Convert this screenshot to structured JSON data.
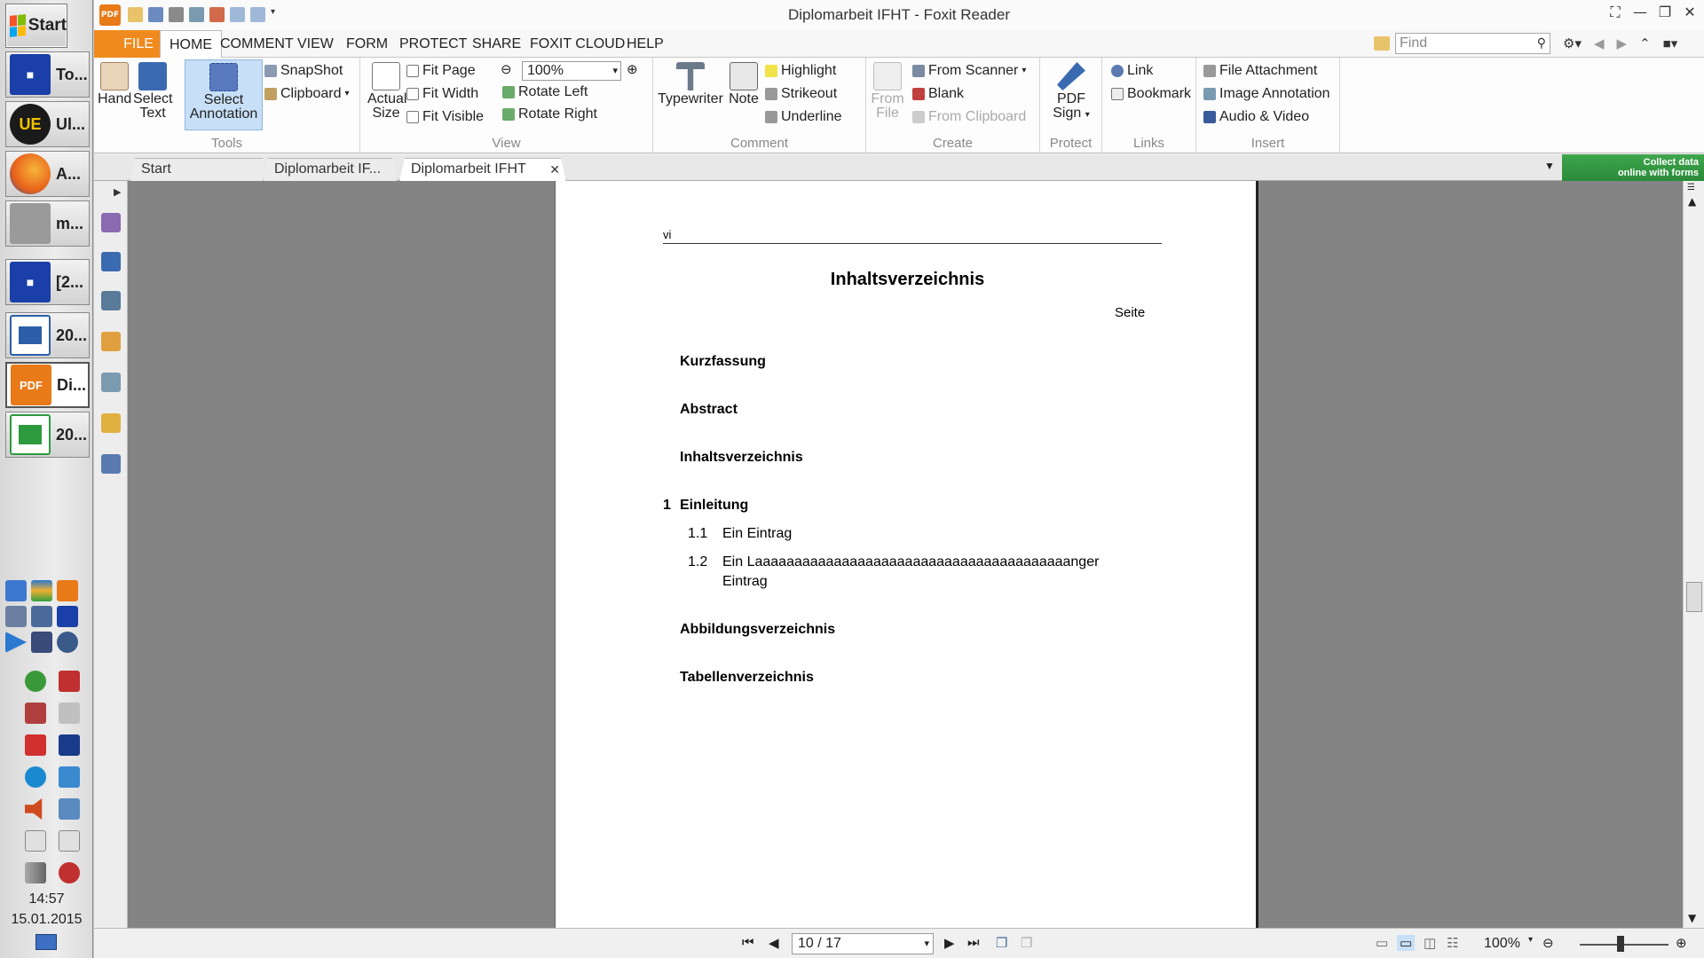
{
  "taskbar": {
    "start_label": "Start",
    "items": [
      {
        "label": "To...",
        "icon": "floppy-icon",
        "color": "#1a3fa8"
      },
      {
        "label": "Ul...",
        "icon": "ultraedit-icon",
        "color": "#1a1a1a"
      },
      {
        "label": "A...",
        "icon": "firefox-icon",
        "color": "#e8621a"
      },
      {
        "label": "m...",
        "icon": "printer-icon",
        "color": "#7a7a7a"
      },
      {
        "label": "[2...",
        "icon": "floppy-icon",
        "color": "#1a3fa8"
      },
      {
        "label": "20...",
        "icon": "writer-icon",
        "color": "#2b5fa8"
      },
      {
        "label": "Di...",
        "icon": "pdf-icon",
        "color": "#e87a18"
      },
      {
        "label": "20...",
        "icon": "calc-icon",
        "color": "#2e9a3e"
      }
    ],
    "clock_time": "14:57",
    "clock_date": "15.01.2015"
  },
  "window": {
    "title": "Diplomarbeit IFHT - Foxit Reader",
    "logo_text": "PDF"
  },
  "ribbon_tabs": [
    "FILE",
    "HOME",
    "COMMENT",
    "VIEW",
    "FORM",
    "PROTECT",
    "SHARE",
    "FOXIT CLOUD",
    "HELP"
  ],
  "find": {
    "placeholder": "Find"
  },
  "ribbon": {
    "tools": {
      "label": "Tools",
      "hand": "Hand",
      "select_text_1": "Select",
      "select_text_2": "Text",
      "select_annot_1": "Select",
      "select_annot_2": "Annotation",
      "snapshot": "SnapShot",
      "clipboard": "Clipboard"
    },
    "view": {
      "label": "View",
      "actual_1": "Actual",
      "actual_2": "Size",
      "fit_page": "Fit Page",
      "fit_width": "Fit Width",
      "fit_visible": "Fit Visible",
      "zoom": "100%",
      "rotate_left": "Rotate Left",
      "rotate_right": "Rotate Right"
    },
    "comment": {
      "label": "Comment",
      "typewriter": "Typewriter",
      "note": "Note",
      "highlight": "Highlight",
      "strikeout": "Strikeout",
      "underline": "Underline"
    },
    "create": {
      "label": "Create",
      "from_file_1": "From",
      "from_file_2": "File",
      "from_scanner": "From Scanner",
      "blank": "Blank",
      "from_clipboard": "From Clipboard"
    },
    "protect": {
      "label": "Protect",
      "pdf_sign_1": "PDF",
      "pdf_sign_2": "Sign"
    },
    "links": {
      "label": "Links",
      "link": "Link",
      "bookmark": "Bookmark"
    },
    "insert": {
      "label": "Insert",
      "file_attachment": "File Attachment",
      "image_annotation": "Image Annotation",
      "audio_video": "Audio & Video"
    }
  },
  "doc_tabs": [
    "Start",
    "Diplomarbeit IF...",
    "Diplomarbeit IFHT"
  ],
  "collect_banner": {
    "line1": "Collect data",
    "line2": "online with forms"
  },
  "document": {
    "header": "vi",
    "title": "Inhaltsverzeichnis",
    "page_col": "Seite",
    "entries": {
      "kurzfassung": "Kurzfassung",
      "abstract": "Abstract",
      "inhalt": "Inhaltsverzeichnis",
      "ch1_num": "1",
      "ch1": "Einleitung",
      "s11_num": "1.1",
      "s11": "Ein Eintrag",
      "s12_num": "1.2",
      "s12_line1": "Ein Laaaaaaaaaaaaaaaaaaaaaaaaaaaaaaaaaaaaaaaanger",
      "s12_line2": "Eintrag",
      "abbildung": "Abbildungsverzeichnis",
      "tabellen": "Tabellenverzeichnis"
    }
  },
  "statusbar": {
    "page": "10 / 17",
    "zoom": "100%"
  }
}
